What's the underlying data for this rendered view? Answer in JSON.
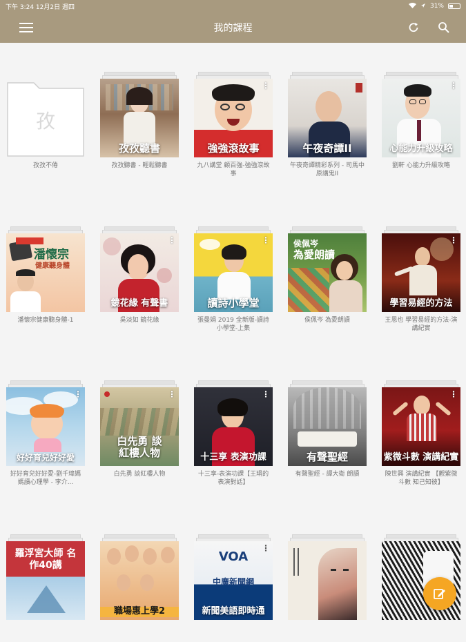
{
  "status_bar": {
    "left": "下午 3:24   12月2日 週四",
    "battery": "31%"
  },
  "app_bar": {
    "title": "我的課程"
  },
  "tiles": [
    {
      "cover_title": "",
      "caption": "孜孜不倦",
      "folder_char": "孜"
    },
    {
      "cover_title": "孜孜聽書",
      "caption": "孜孜聽書 - 輕鬆聽書"
    },
    {
      "cover_title": "強強滾故事",
      "caption": "九八講堂 顧百強-強強滾故事"
    },
    {
      "cover_title": "午夜奇譚II",
      "caption": "午夜奇譚精彩系列 - 司馬中原講鬼II"
    },
    {
      "cover_title": "心能力升級攻略",
      "caption": "劉軒 心能力升級攻略"
    },
    {
      "cover_title": "潘懷宗",
      "cover_sub": "健康聽身體",
      "caption": "潘懷宗健康聽身體-1"
    },
    {
      "cover_title": "鏡花緣 有聲書",
      "caption": "吳淡如 鏡花緣"
    },
    {
      "cover_title": "讀詩小學堂",
      "caption": "張曼娟 2019 全新版-讀詩小學堂-上集"
    },
    {
      "cover_title": "為愛朗讀",
      "cover_sub": "侯佩岑",
      "caption": "侯佩岑 為愛朗讀"
    },
    {
      "cover_title": "學習易經的方法",
      "caption": "王恩也 學習易經的方法-演講紀實"
    },
    {
      "cover_title": "好好育兒好好愛",
      "caption": "好好育兒好好愛-劉千瑋媽媽讀心理學 - 李介..."
    },
    {
      "cover_title": "白先勇 談紅樓人物",
      "caption": "白先勇 談紅樓人物"
    },
    {
      "cover_title": "十三享 表演功課",
      "caption": "十三享-表演功課【王琄的表演對話】"
    },
    {
      "cover_title": "有聲聖經",
      "caption": "有聲聖經 - 譚大衛 朗讀"
    },
    {
      "cover_title": "紫微斗數 演講紀實",
      "caption": "陳世興 演講紀實 【觀紫微斗數 知己知彼】"
    },
    {
      "cover_title": "羅浮宮大師 名作40講",
      "caption": ""
    },
    {
      "cover_title": "職場惠上學2",
      "caption": ""
    },
    {
      "cover_title": "新聞美語即時通",
      "cover_sub": "VOA",
      "cover_sub2": "中廣新聞網",
      "caption": ""
    },
    {
      "cover_title": "",
      "caption": ""
    },
    {
      "cover_title": "",
      "caption": ""
    }
  ]
}
